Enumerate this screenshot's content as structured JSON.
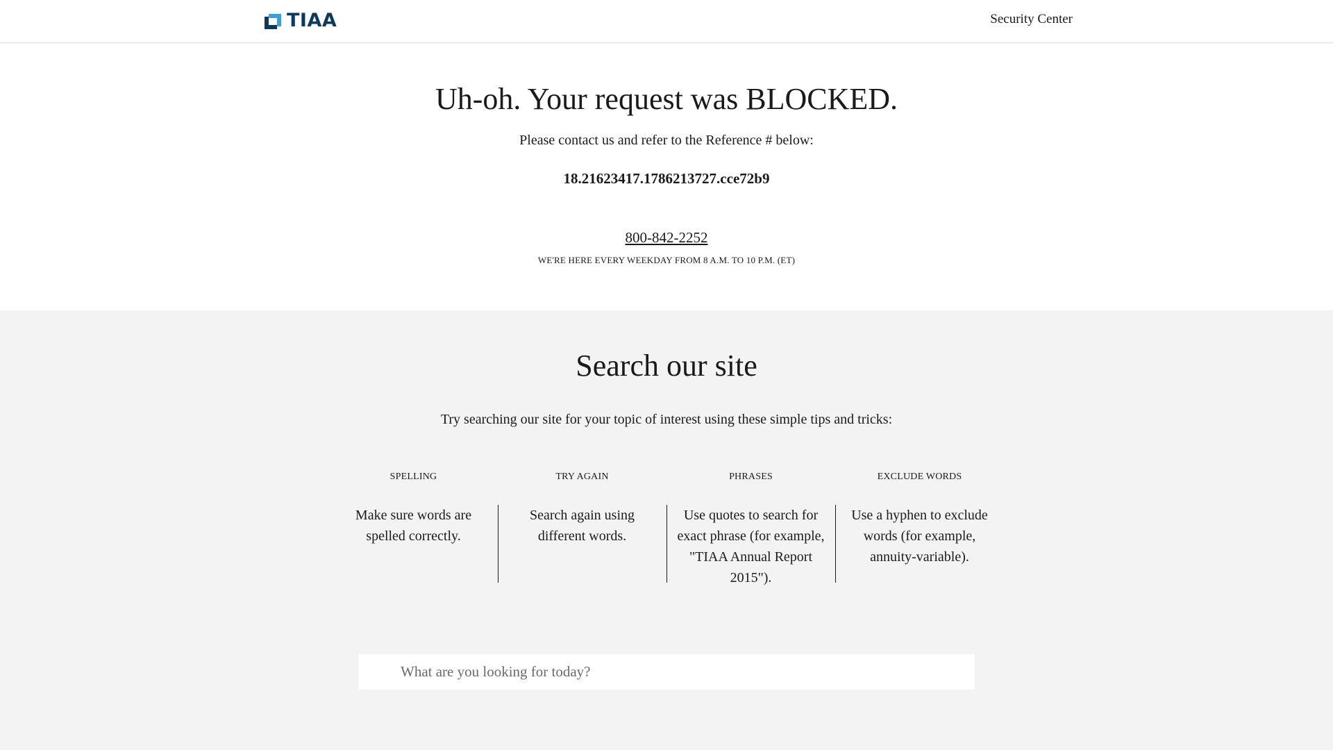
{
  "header": {
    "logo_text": "TIAA",
    "security_link": "Security Center"
  },
  "blocked": {
    "title": "Uh-oh. Your request was BLOCKED.",
    "contact_text": "Please contact us and refer to the Reference # below:",
    "reference": "18.21623417.1786213727.cce72b9",
    "phone": "800-842-2252",
    "hours": "WE'RE HERE EVERY WEEKDAY FROM 8 A.M. TO 10 P.M. (ET)"
  },
  "search": {
    "title": "Search our site",
    "intro": "Try searching our site for your topic of interest using these simple tips and tricks:",
    "tips": [
      {
        "title": "SPELLING",
        "body": "Make sure words are spelled correctly."
      },
      {
        "title": "TRY AGAIN",
        "body": "Search again using different words."
      },
      {
        "title": "PHRASES",
        "body": "Use quotes to search for exact phrase (for example, \"TIAA Annual Report 2015\")."
      },
      {
        "title": "EXCLUDE WORDS",
        "body": "Use a hyphen to exclude words (for example, annuity-variable)."
      }
    ],
    "placeholder": "What are you looking for today?",
    "value": ""
  },
  "colors": {
    "logo_dark": "#0b3a5c",
    "logo_light": "#3aa0d8",
    "page_bg": "#f3f3f3"
  }
}
